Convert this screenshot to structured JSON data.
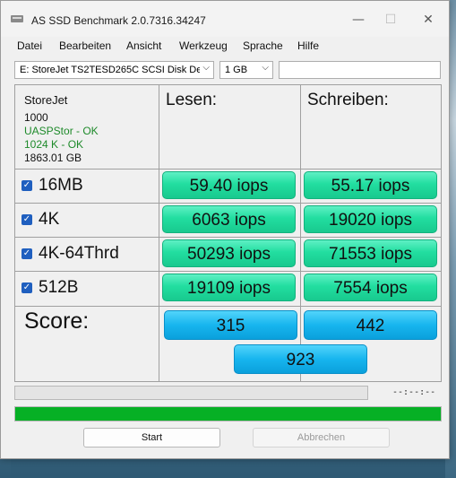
{
  "window": {
    "title": "AS SSD Benchmark 2.0.7316.34247",
    "controls": {
      "minimize": "—",
      "maximize": "☐",
      "close": "✕"
    }
  },
  "menu": [
    "Datei",
    "Bearbeiten",
    "Ansicht",
    "Werkzeug",
    "Sprache",
    "Hilfe"
  ],
  "toolbar": {
    "drive": "E: StoreJet TS2TESD265C SCSI Disk De",
    "size": "1 GB",
    "text_value": ""
  },
  "drive_info": {
    "name": "StoreJet",
    "firmware": "1000",
    "driver_status": "UASPStor - OK",
    "alignment_status": "1024 K - OK",
    "capacity": "1863.01 GB"
  },
  "columns": {
    "read": "Lesen:",
    "write": "Schreiben:"
  },
  "rows": [
    {
      "label": "16MB",
      "checked": true,
      "read": "59.40 iops",
      "write": "55.17 iops"
    },
    {
      "label": "4K",
      "checked": true,
      "read": "6063 iops",
      "write": "19020 iops"
    },
    {
      "label": "4K-64Thrd",
      "checked": true,
      "read": "50293 iops",
      "write": "71553 iops"
    },
    {
      "label": "512B",
      "checked": true,
      "read": "19109 iops",
      "write": "7554 iops"
    }
  ],
  "score": {
    "label": "Score:",
    "read": "315",
    "write": "442",
    "total": "923"
  },
  "progress": {
    "elapsed": "--:--:--",
    "overall_fraction": 1.0,
    "current_fraction": 0.0
  },
  "buttons": {
    "start": "Start",
    "cancel": "Abbrechen"
  },
  "colors": {
    "value_green": "#22dea0",
    "score_blue": "#17b5ee",
    "progress_green": "#06b025",
    "ok_text": "#1e8a2a"
  }
}
